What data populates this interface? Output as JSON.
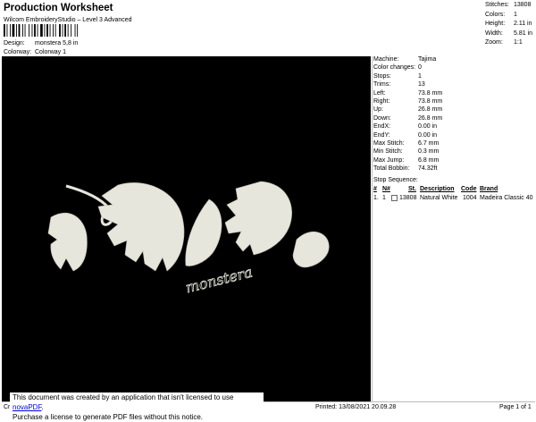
{
  "header": {
    "title": "Production Worksheet",
    "subtitle": "Wilcom EmbroideryStudio – Level 3 Advanced",
    "design_label": "Design:",
    "design_value": "monstera 5,8 in",
    "colorway_label": "Colorway:",
    "colorway_value": "Colorway 1"
  },
  "summary": [
    {
      "label": "Stitches:",
      "value": "13808"
    },
    {
      "label": "Colors:",
      "value": "1"
    },
    {
      "label": "Height:",
      "value": "2.11 in"
    },
    {
      "label": "Width:",
      "value": "5.81 in"
    },
    {
      "label": "Zoom:",
      "value": "1:1"
    }
  ],
  "machine": [
    {
      "label": "Machine:",
      "value": "Tajima"
    },
    {
      "label": "Color changes:",
      "value": "0"
    },
    {
      "label": "Stops:",
      "value": "1"
    },
    {
      "label": "Trims:",
      "value": "13"
    },
    {
      "label": "Left:",
      "value": "73.8 mm"
    },
    {
      "label": "Right:",
      "value": "73.8 mm"
    },
    {
      "label": "Up:",
      "value": "26.8 mm"
    },
    {
      "label": "Down:",
      "value": "26.8 mm"
    },
    {
      "label": "EndX:",
      "value": "0.00 in"
    },
    {
      "label": "EndY:",
      "value": "0.00 in"
    },
    {
      "label": "Max Stitch:",
      "value": "6.7 mm"
    },
    {
      "label": "Min Stitch:",
      "value": "0.3 mm"
    },
    {
      "label": "Max Jump:",
      "value": "6.8 mm"
    },
    {
      "label": "Total Bobbin:",
      "value": "74.32ft"
    }
  ],
  "stop_sequence": {
    "title": "Stop Sequence:",
    "headers": {
      "hash": "#",
      "n": "N#",
      "st": "St.",
      "description": "Description",
      "code": "Code",
      "brand": "Brand"
    },
    "rows": [
      {
        "hash": "1.",
        "n": "1",
        "st": "13808",
        "description": "Natural White",
        "code": "1004",
        "brand": "Madeira Classic 40"
      }
    ]
  },
  "design": {
    "text": "monstera",
    "thread_color": "#e8e8e0",
    "background": "#000000"
  },
  "footer": {
    "cr": "Cr",
    "printed": "Printed: 13/08/2021 20.09.28",
    "page": "Page 1 of 1",
    "notice_line1": "This document was created by an application that isn't licensed to use ",
    "notice_link": "novaPDF",
    "notice_line1_end": ".",
    "notice_line2": "Purchase a license to generate PDF files without this notice."
  }
}
